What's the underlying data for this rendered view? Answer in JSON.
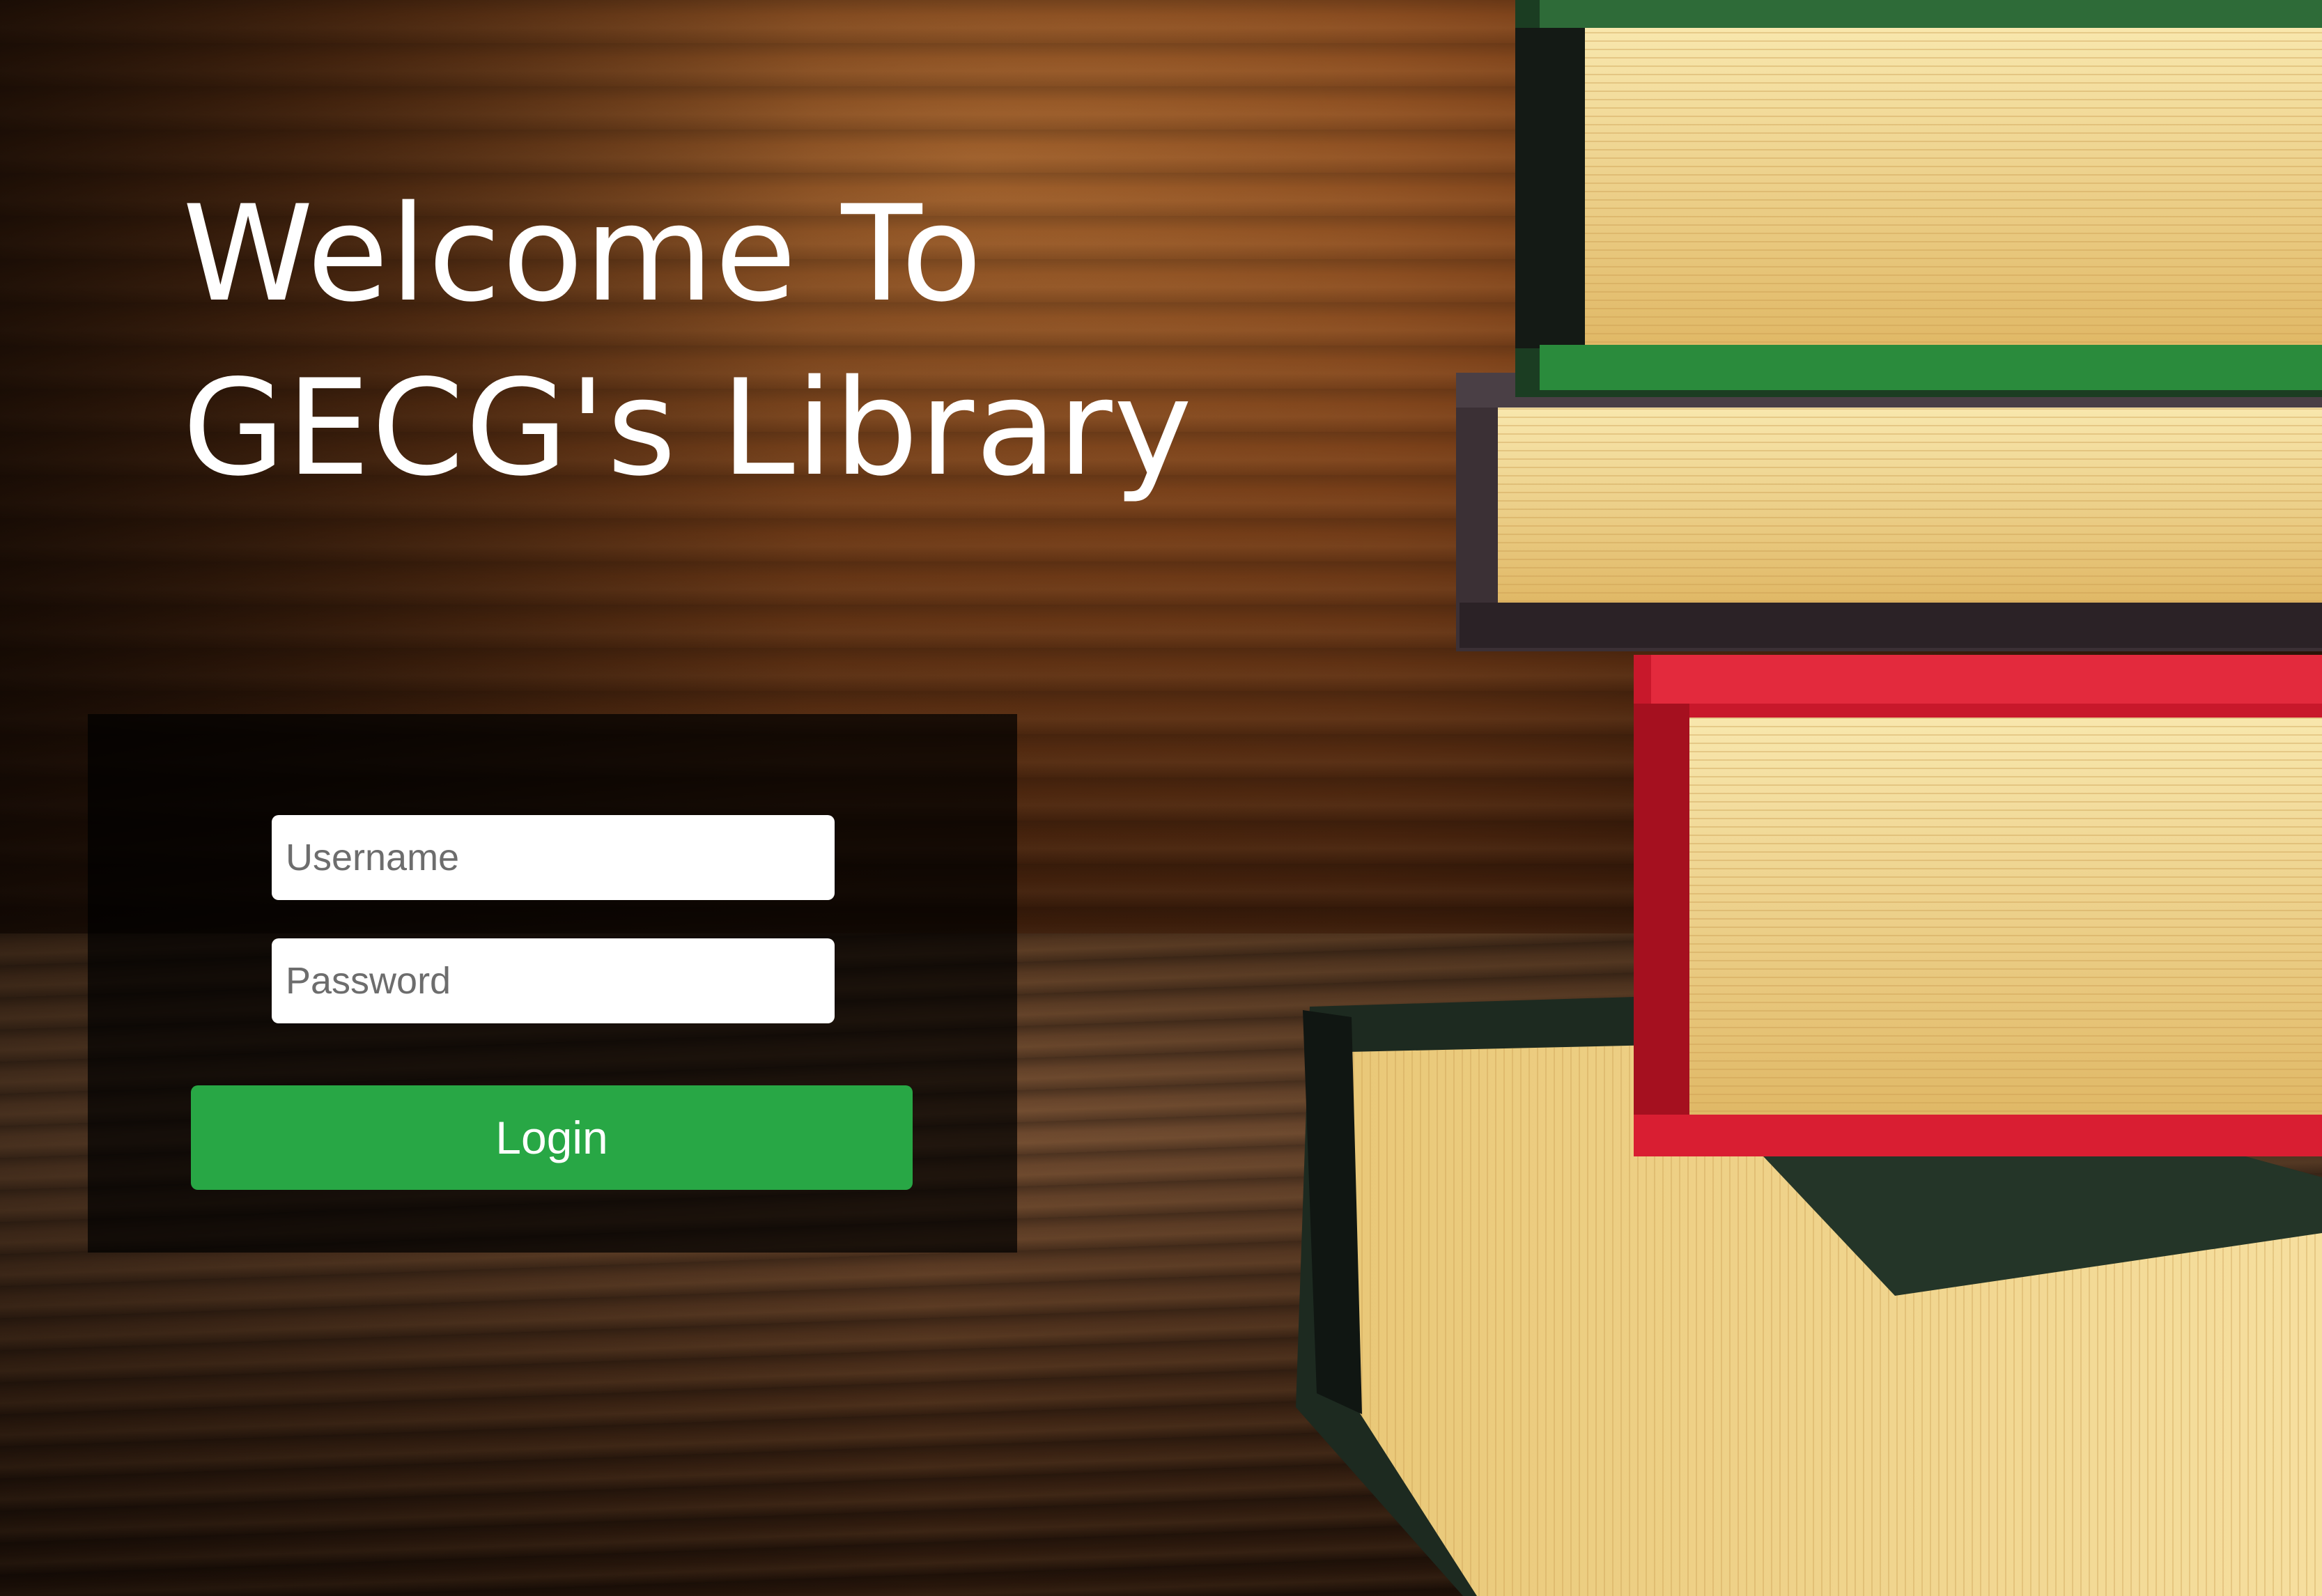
{
  "header": {
    "title_line1": "Welcome To",
    "title_line2": "GECG's Library"
  },
  "login_form": {
    "username_placeholder": "Username",
    "username_value": "",
    "password_placeholder": "Password",
    "password_value": "",
    "login_label": "Login"
  },
  "colors": {
    "login_button": "#28a745",
    "panel_overlay": "rgba(0,0,0,0.72)",
    "title_text": "#ffffff"
  }
}
